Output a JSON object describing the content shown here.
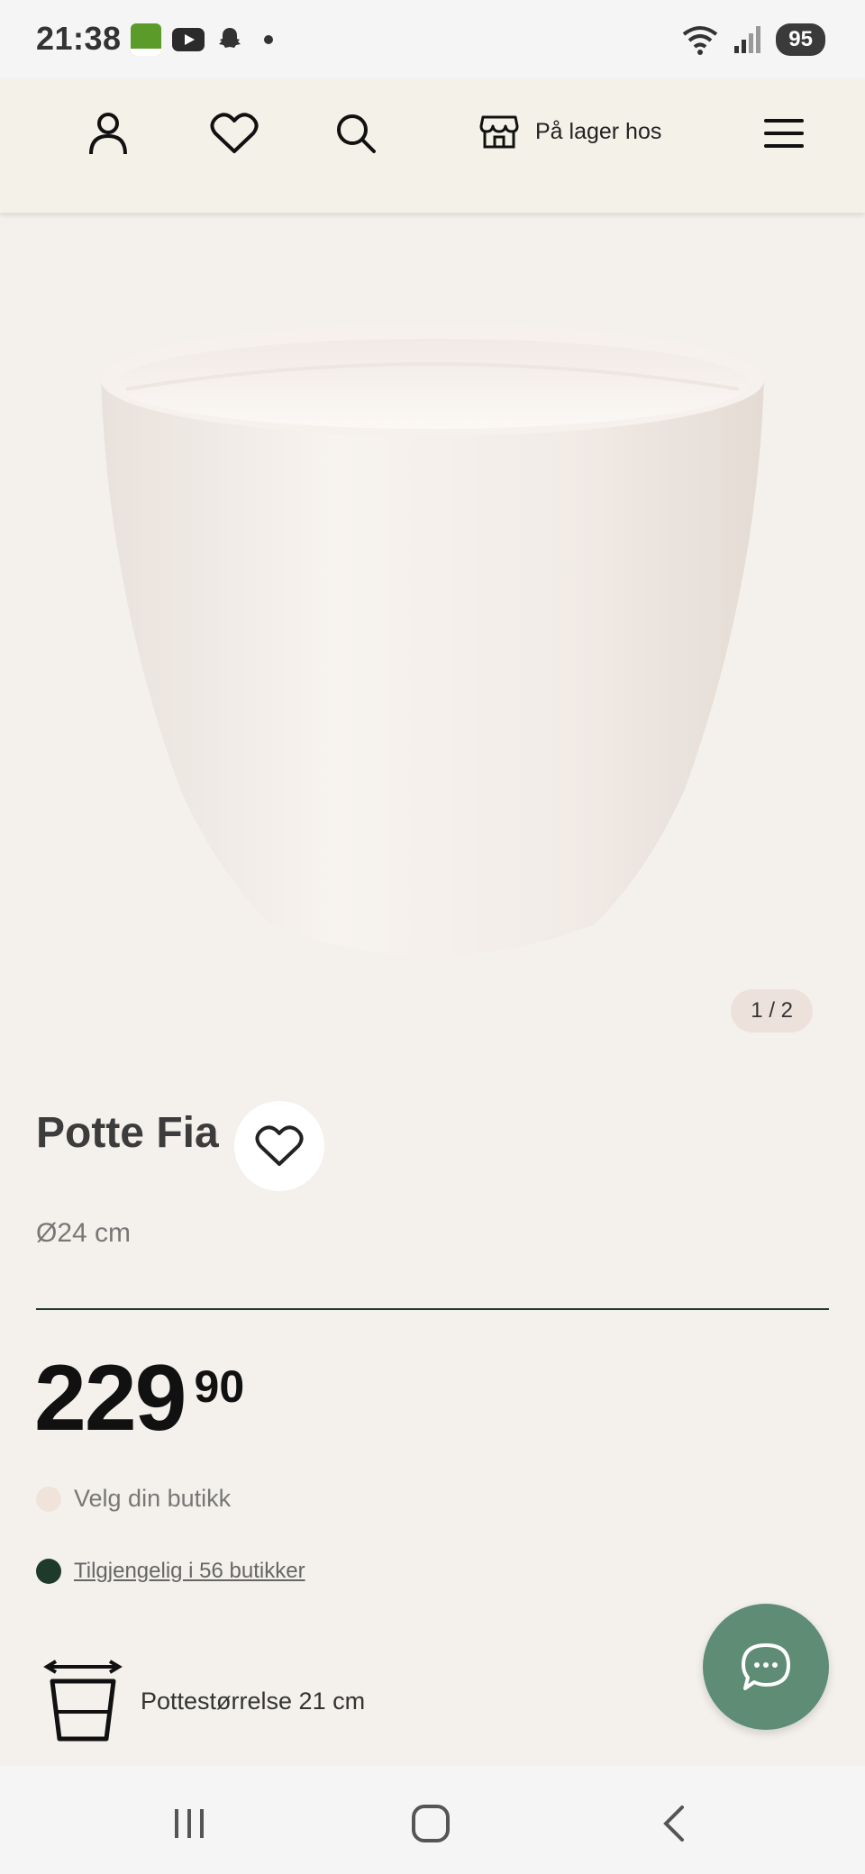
{
  "status_bar": {
    "time": "21:38",
    "battery": "95",
    "icons": [
      "kiwi-app-icon",
      "youtube-icon",
      "snapchat-icon",
      "notification-dot",
      "wifi-icon",
      "signal-icon",
      "battery-icon"
    ]
  },
  "header": {
    "icons": [
      "account-icon",
      "heart-icon",
      "search-icon",
      "store-icon",
      "menu-icon"
    ],
    "store_label": "På lager hos"
  },
  "gallery": {
    "pager": "1 / 2"
  },
  "product": {
    "title": "Potte Fia",
    "size": "Ø24 cm",
    "price_main": "229",
    "price_decimals": "90",
    "store_select": "Velg din butikk",
    "availability": "Tilgjengelig i 56 butikker",
    "pot_size": "Pottestørrelse 21 cm"
  },
  "colors": {
    "background": "#f4f1ec",
    "availability_dot": "#1d3b28",
    "store_dot": "#efe3da",
    "chat_fab": "#5e8c74",
    "divider": "#1f3a2a"
  },
  "nav": {
    "icons": [
      "recent-apps-icon",
      "home-icon",
      "back-icon"
    ]
  }
}
